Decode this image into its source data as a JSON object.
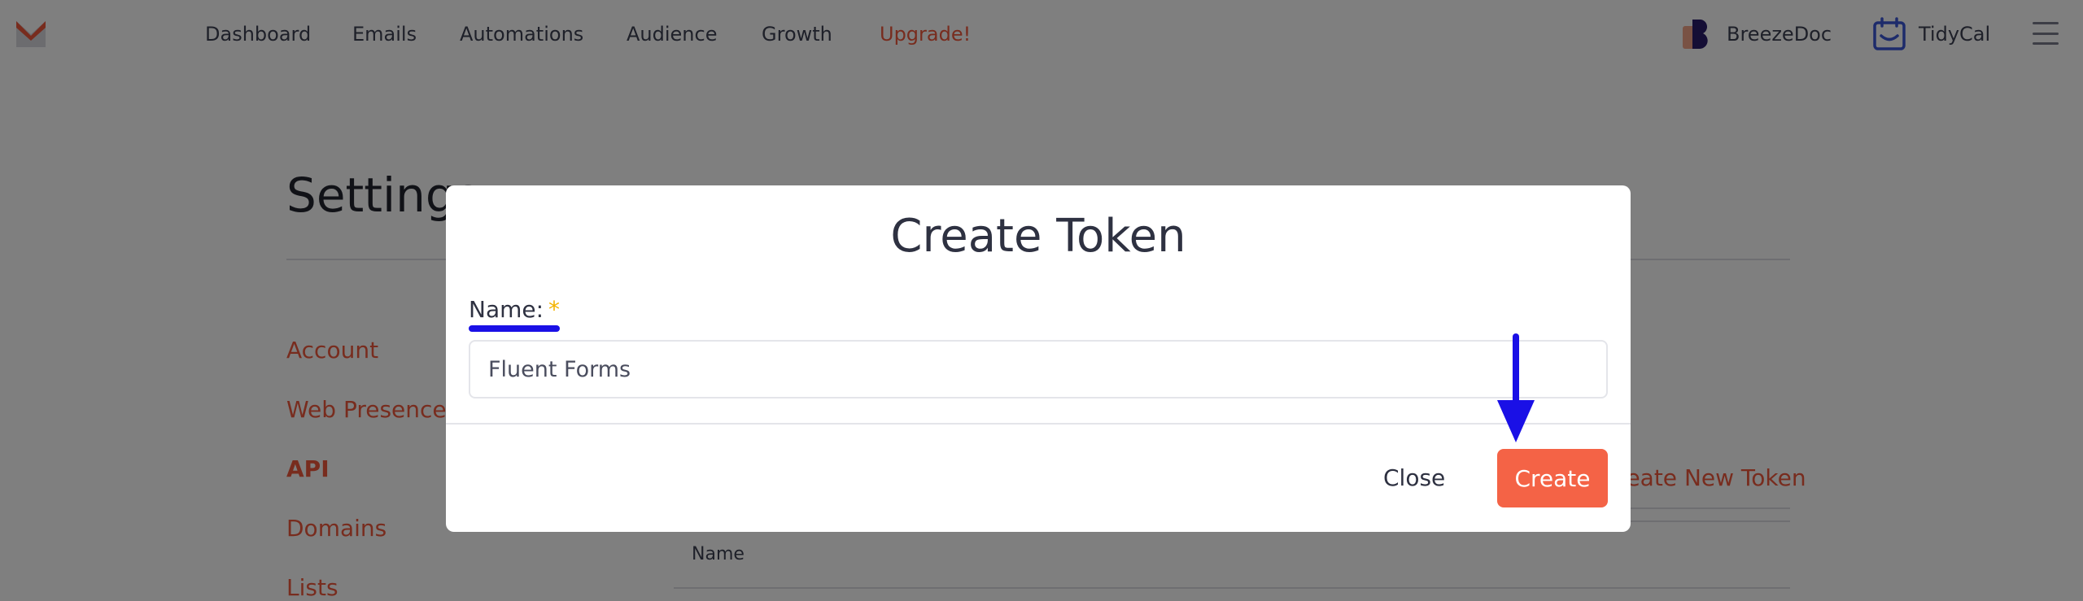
{
  "nav": {
    "items": [
      "Dashboard",
      "Emails",
      "Automations",
      "Audience",
      "Growth"
    ],
    "upgrade_label": "Upgrade!",
    "apps": [
      "BreezeDoc",
      "TidyCal"
    ]
  },
  "page": {
    "title": "Settings",
    "sidebar": [
      "Account",
      "Web Presence",
      "API",
      "Domains",
      "Lists"
    ],
    "create_new_token_label": "Create New Token",
    "table_header_name": "Name"
  },
  "modal": {
    "title": "Create Token",
    "name_label": "Name:",
    "required_mark": "*",
    "name_value": "Fluent Forms",
    "close_label": "Close",
    "create_label": "Create"
  },
  "colors": {
    "brand": "#f0593c",
    "create_button": "#f46346",
    "annotation": "#1a10e6"
  }
}
